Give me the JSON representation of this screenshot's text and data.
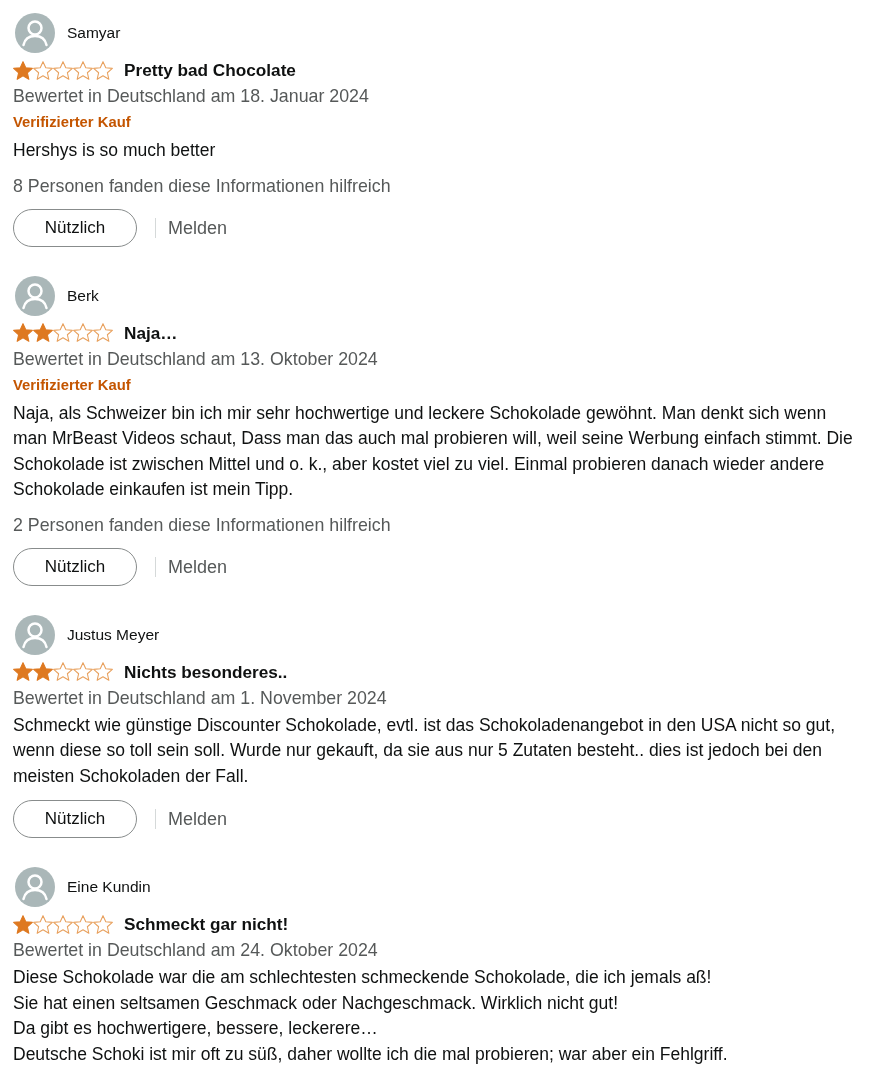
{
  "reviews": [
    {
      "reviewer": "Samyar",
      "stars": 1,
      "title": "Pretty bad Chocolate",
      "date": "Bewertet in Deutschland am 18. Januar 2024",
      "badge": "Verifizierter Kauf",
      "body": "Hershys is so much better",
      "helpful_count": "8 Personen fanden diese Informationen hilfreich",
      "helpful_button": "Nützlich",
      "report_link": "Melden"
    },
    {
      "reviewer": "Berk",
      "stars": 2,
      "title": "Naja…",
      "date": "Bewertet in Deutschland am 13. Oktober 2024",
      "badge": "Verifizierter Kauf",
      "body": "Naja, als Schweizer bin ich mir sehr hochwertige und leckere Schokolade gewöhnt. Man denkt sich wenn man MrBeast Videos schaut, Dass man das auch mal probieren will, weil seine Werbung einfach stimmt. Die Schokolade ist zwischen Mittel und o. k., aber kostet viel zu viel. Einmal probieren danach wieder andere Schokolade einkaufen ist mein Tipp.",
      "helpful_count": "2 Personen fanden diese Informationen hilfreich",
      "helpful_button": "Nützlich",
      "report_link": "Melden"
    },
    {
      "reviewer": "Justus Meyer",
      "stars": 2,
      "title": "Nichts besonderes..",
      "date": "Bewertet in Deutschland am 1. November 2024",
      "body": "Schmeckt wie günstige Discounter Schokolade, evtl. ist das Schokoladenangebot in den USA nicht so gut, wenn diese so toll sein soll. Wurde nur gekauft, da sie aus nur 5 Zutaten besteht.. dies ist jedoch bei den meisten Schokoladen der Fall.",
      "helpful_button": "Nützlich",
      "report_link": "Melden"
    },
    {
      "reviewer": "Eine Kundin",
      "stars": 1,
      "title": "Schmeckt gar nicht!",
      "date": "Bewertet in Deutschland am 24. Oktober 2024",
      "body": "Diese Schokolade war die am schlechtesten schmeckende Schokolade, die ich jemals aß!\nSie hat einen seltsamen Geschmack oder Nachgeschmack. Wirklich nicht gut!\nDa gibt es hochwertigere, bessere, leckerere…\nDeutsche Schoki ist mir oft zu süß, daher wollte ich die mal probieren; war aber ein Fehlgriff."
    }
  ]
}
